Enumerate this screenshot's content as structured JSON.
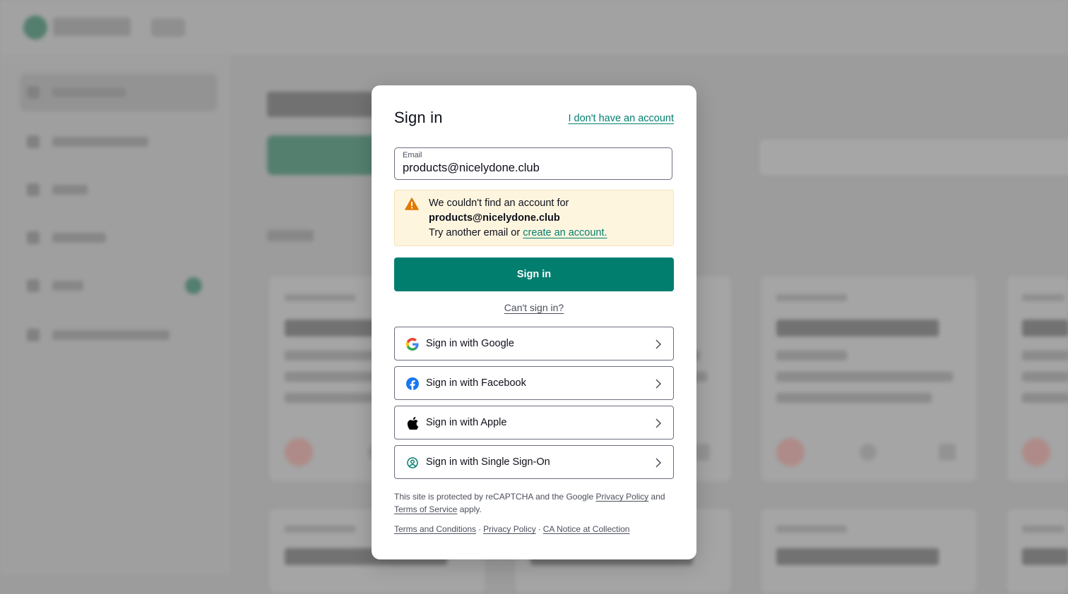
{
  "modal": {
    "title": "Sign in",
    "no_account_link": "I don't have an account",
    "email": {
      "label": "Email",
      "value": "products@nicelydone.club"
    },
    "alert": {
      "line1": "We couldn't find an account for",
      "email": "products@nicelydone.club",
      "line3_prefix": "Try another email or",
      "create_link": "create an account."
    },
    "primary_button": "Sign in",
    "cant_sign_in": "Can't sign in?",
    "providers": [
      {
        "label": "Sign in with Google",
        "icon": "google-icon"
      },
      {
        "label": "Sign in with Facebook",
        "icon": "facebook-icon"
      },
      {
        "label": "Sign in with Apple",
        "icon": "apple-icon"
      },
      {
        "label": "Sign in with Single Sign-On",
        "icon": "sso-user-icon"
      }
    ],
    "legal": {
      "prefix": "This site is protected by reCAPTCHA and the Google",
      "privacy": "Privacy Policy",
      "and": "and",
      "terms": "Terms of Service",
      "suffix": "apply."
    },
    "footer_links": {
      "terms": "Terms and Conditions",
      "privacy": "Privacy Policy",
      "ca_notice": "CA Notice at Collection",
      "separator": "·"
    }
  },
  "colors": {
    "brand_green": "#027e6f",
    "alert_bg": "#fef5df",
    "warning_orange": "#e07a00",
    "overlay": "#9c9c9c"
  }
}
